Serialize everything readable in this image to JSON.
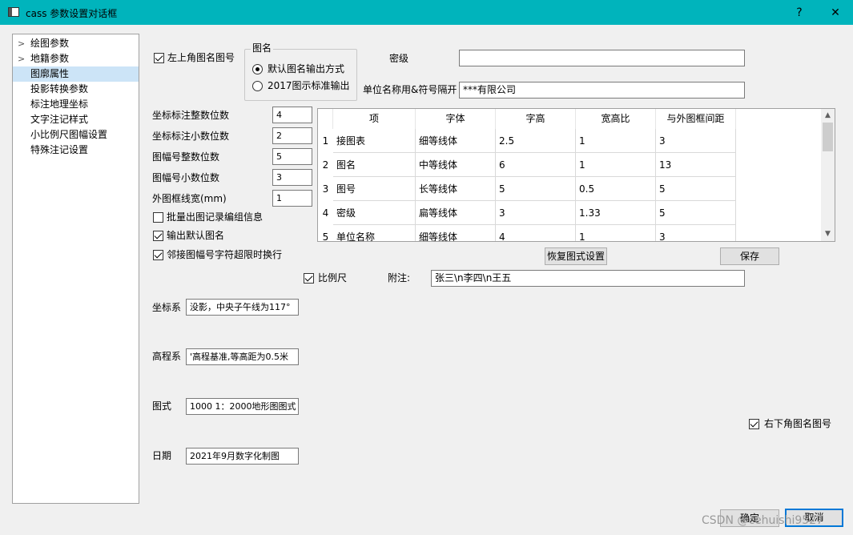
{
  "window": {
    "title": "cass 参数设置对话框",
    "help_label": "?",
    "close_label": "✕"
  },
  "sidebar": {
    "items": [
      {
        "label": "绘图参数",
        "expandable": true
      },
      {
        "label": "地籍参数",
        "expandable": true
      },
      {
        "label": "图廓属性",
        "selected": true
      },
      {
        "label": "投影转换参数"
      },
      {
        "label": "标注地理坐标"
      },
      {
        "label": "文字注记样式"
      },
      {
        "label": "小比例尺图幅设置"
      },
      {
        "label": "特殊注记设置"
      }
    ]
  },
  "options": {
    "top_left_title_label": "左上角图名图号",
    "top_left_title_checked": true,
    "group_title": "图名",
    "radio_default_label": "默认图名输出方式",
    "radio_default_checked": true,
    "radio_2017_label": "2017图示标准输出",
    "radio_2017_checked": false,
    "secret_label": "密级",
    "secret_value": "",
    "unit_label": "单位名称用&符号隔开",
    "unit_value": "***有限公司"
  },
  "numbers": {
    "coord_int_label": "坐标标注整数位数",
    "coord_int_value": "4",
    "coord_dec_label": "坐标标注小数位数",
    "coord_dec_value": "2",
    "sheet_int_label": "图幅号整数位数",
    "sheet_int_value": "5",
    "sheet_dec_label": "图幅号小数位数",
    "sheet_dec_value": "3",
    "frame_width_label": "外图框线宽(mm)",
    "frame_width_value": "1"
  },
  "checks": {
    "batch_label": "批量出图记录编组信息",
    "batch_checked": false,
    "default_name_label": "输出默认图名",
    "default_name_checked": true,
    "wrap_label": "邻接图幅号字符超限时换行",
    "wrap_checked": true,
    "scale_label": "比例尺",
    "scale_checked": true,
    "bottom_right_label": "右下角图名图号",
    "bottom_right_checked": true
  },
  "table": {
    "headers": [
      "项",
      "字体",
      "字高",
      "宽高比",
      "与外图框间距"
    ],
    "rows": [
      {
        "num": "1",
        "cells": [
          "接图表",
          "细等线体",
          "2.5",
          "1",
          "3"
        ]
      },
      {
        "num": "2",
        "cells": [
          "图名",
          "中等线体",
          "6",
          "1",
          "13"
        ]
      },
      {
        "num": "3",
        "cells": [
          "图号",
          "长等线体",
          "5",
          "0.5",
          "5"
        ]
      },
      {
        "num": "4",
        "cells": [
          "密级",
          "扁等线体",
          "3",
          "1.33",
          "5"
        ]
      },
      {
        "num": "5",
        "cells": [
          "单位名称",
          "细等线体",
          "4",
          "1",
          "3"
        ]
      }
    ]
  },
  "buttons": {
    "restore": "恢复图式设置",
    "save": "保存",
    "ok": "确定",
    "cancel": "取消"
  },
  "note": {
    "label": "附注:",
    "value": "张三\\n李四\\n王五"
  },
  "fields": {
    "coord_sys_label": "坐标系",
    "coord_sys_value": "没影，中央子午线为117°",
    "elev_sys_label": "高程系",
    "elev_sys_value": "'高程基准,等高距为0.5米",
    "style_label": "图式",
    "style_value": "1000 1：2000地形图图式",
    "date_label": "日期",
    "date_value": "2021年9月数字化制图"
  },
  "watermark": "CSDN @cehuishi9527"
}
